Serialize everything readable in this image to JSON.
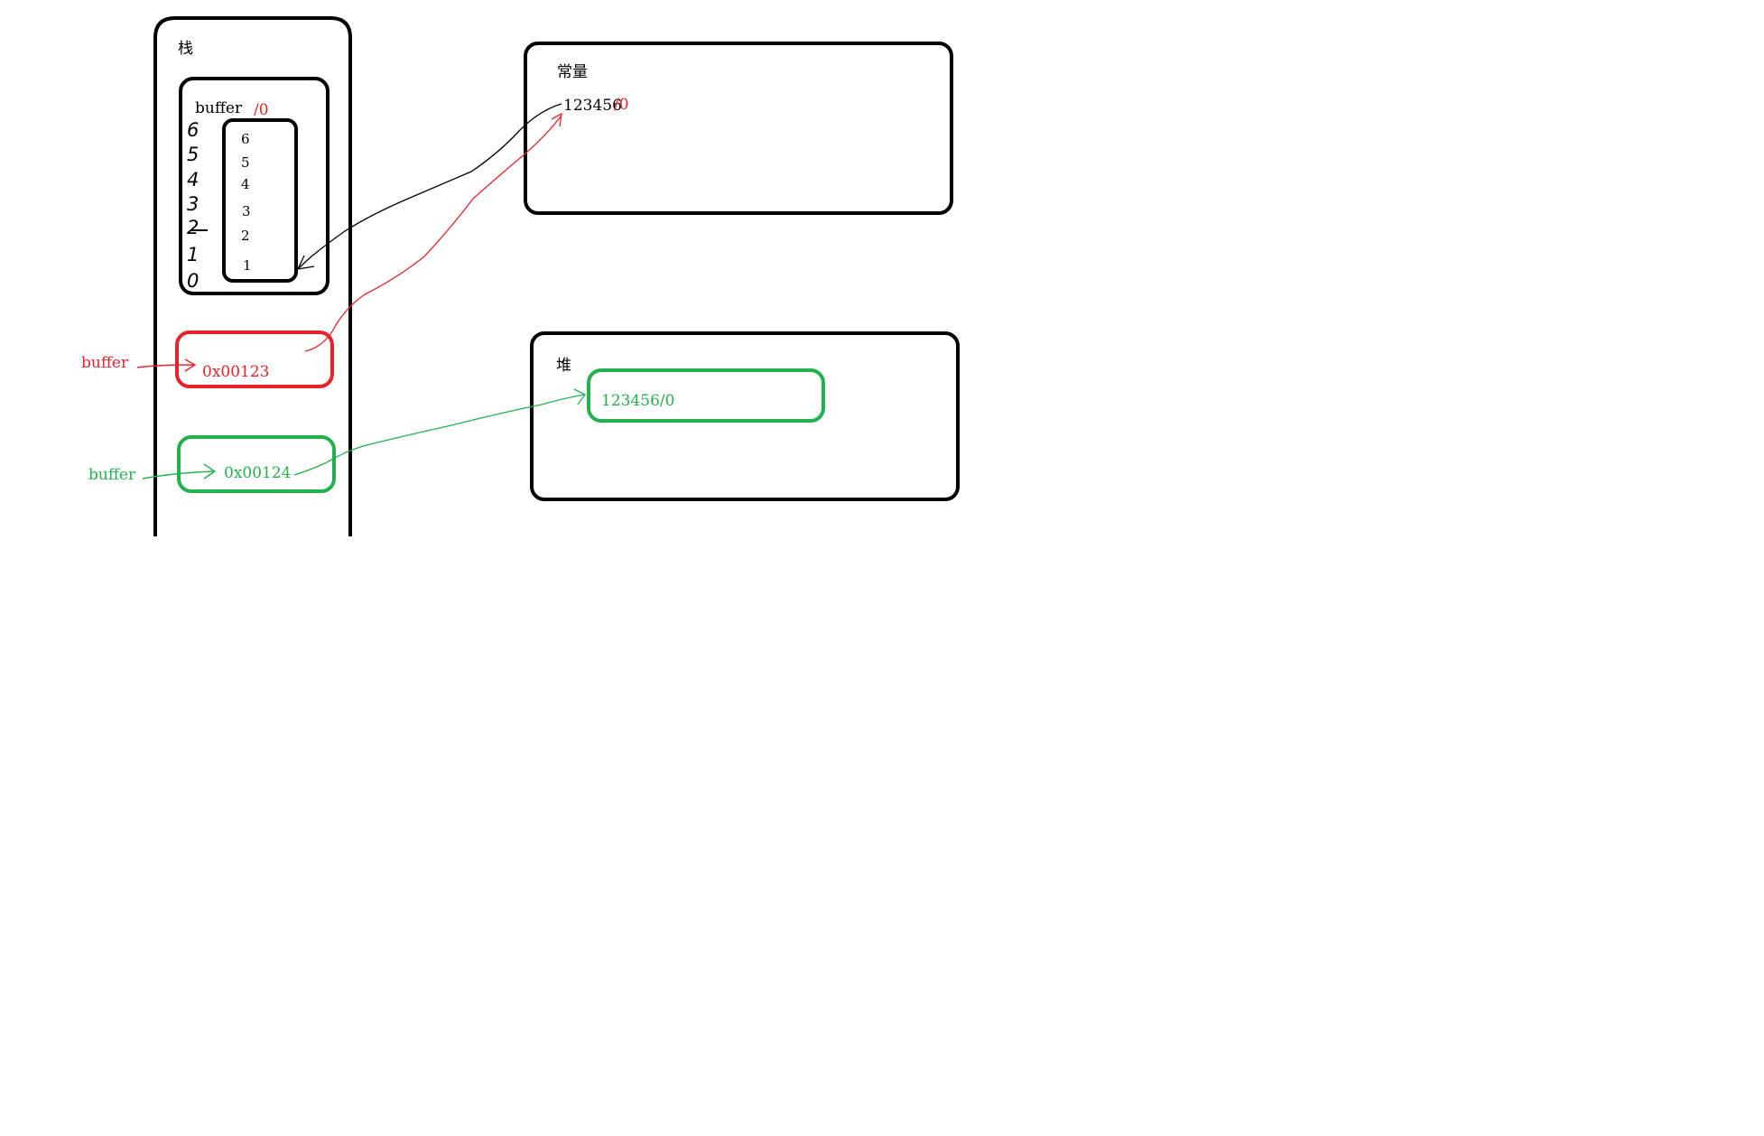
{
  "colors": {
    "black": "#000000",
    "red": "#e8222a",
    "green": "#22b14c"
  },
  "stack": {
    "title": "栈",
    "buffer_array": {
      "label": "buffer",
      "terminator": "/0",
      "index_digits": [
        "6",
        "5",
        "4",
        "3",
        "2",
        "1",
        "0"
      ],
      "cells": [
        "6",
        "5",
        "4",
        "3",
        "2",
        "1"
      ]
    },
    "red_pointer": {
      "label": "buffer",
      "address": "0x00123"
    },
    "green_pointer": {
      "label": "buffer",
      "address": "0x00124"
    }
  },
  "constants": {
    "title": "常量",
    "value": "123456",
    "terminator": "/0"
  },
  "heap": {
    "title": "堆",
    "value": "123456/0"
  }
}
